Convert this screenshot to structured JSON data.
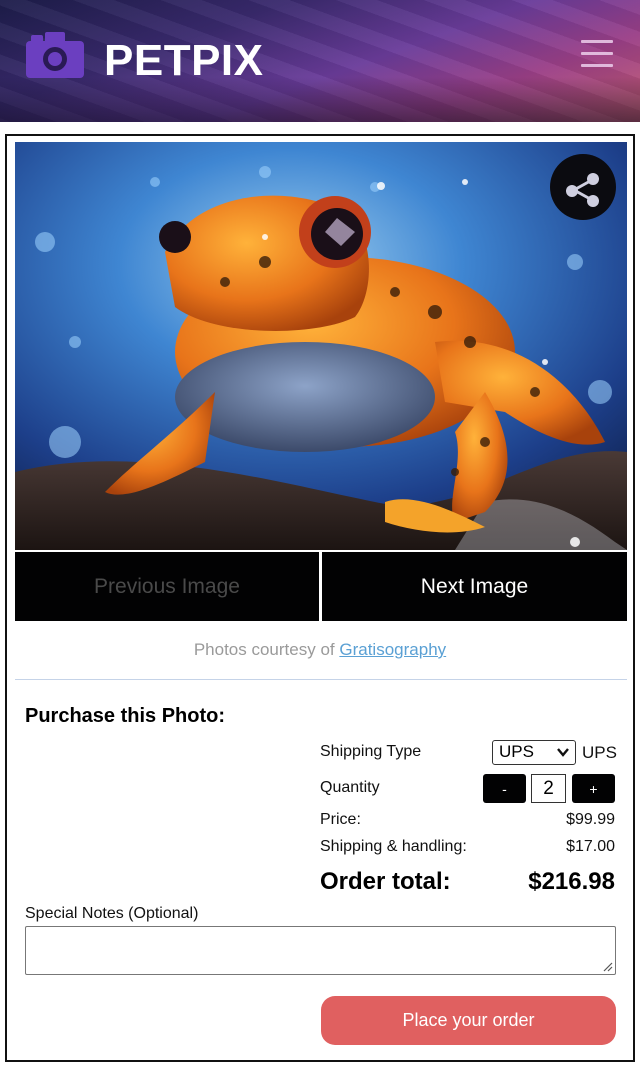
{
  "header": {
    "brand": "PETPIX",
    "logo_icon": "camera-icon",
    "menu_icon": "hamburger-menu-icon"
  },
  "gallery": {
    "image_subject": "orange and black frog on a wet rock against a blue background",
    "share_icon": "share-icon",
    "prev_label": "Previous Image",
    "next_label": "Next Image",
    "credit_prefix": "Photos courtesy of",
    "credit_link": "Gratisography"
  },
  "purchase": {
    "title": "Purchase this Photo:",
    "shipping_type_label": "Shipping Type",
    "shipping_selected": "UPS",
    "shipping_suffix": "UPS",
    "quantity_label": "Quantity",
    "qty_minus": "-",
    "quantity": "2",
    "qty_plus": "+",
    "price_label": "Price:",
    "price_value": "$99.99",
    "shipping_handling_label": "Shipping & handling:",
    "shipping_handling_value": "$17.00",
    "total_label": "Order total:",
    "total_value": "$216.98",
    "notes_label": "Special Notes (Optional)",
    "notes_value": "",
    "order_button": "Place your order"
  },
  "colors": {
    "accent_button": "#e06060",
    "nav_button_bg": "#020203",
    "link": "#5aa0d4"
  }
}
